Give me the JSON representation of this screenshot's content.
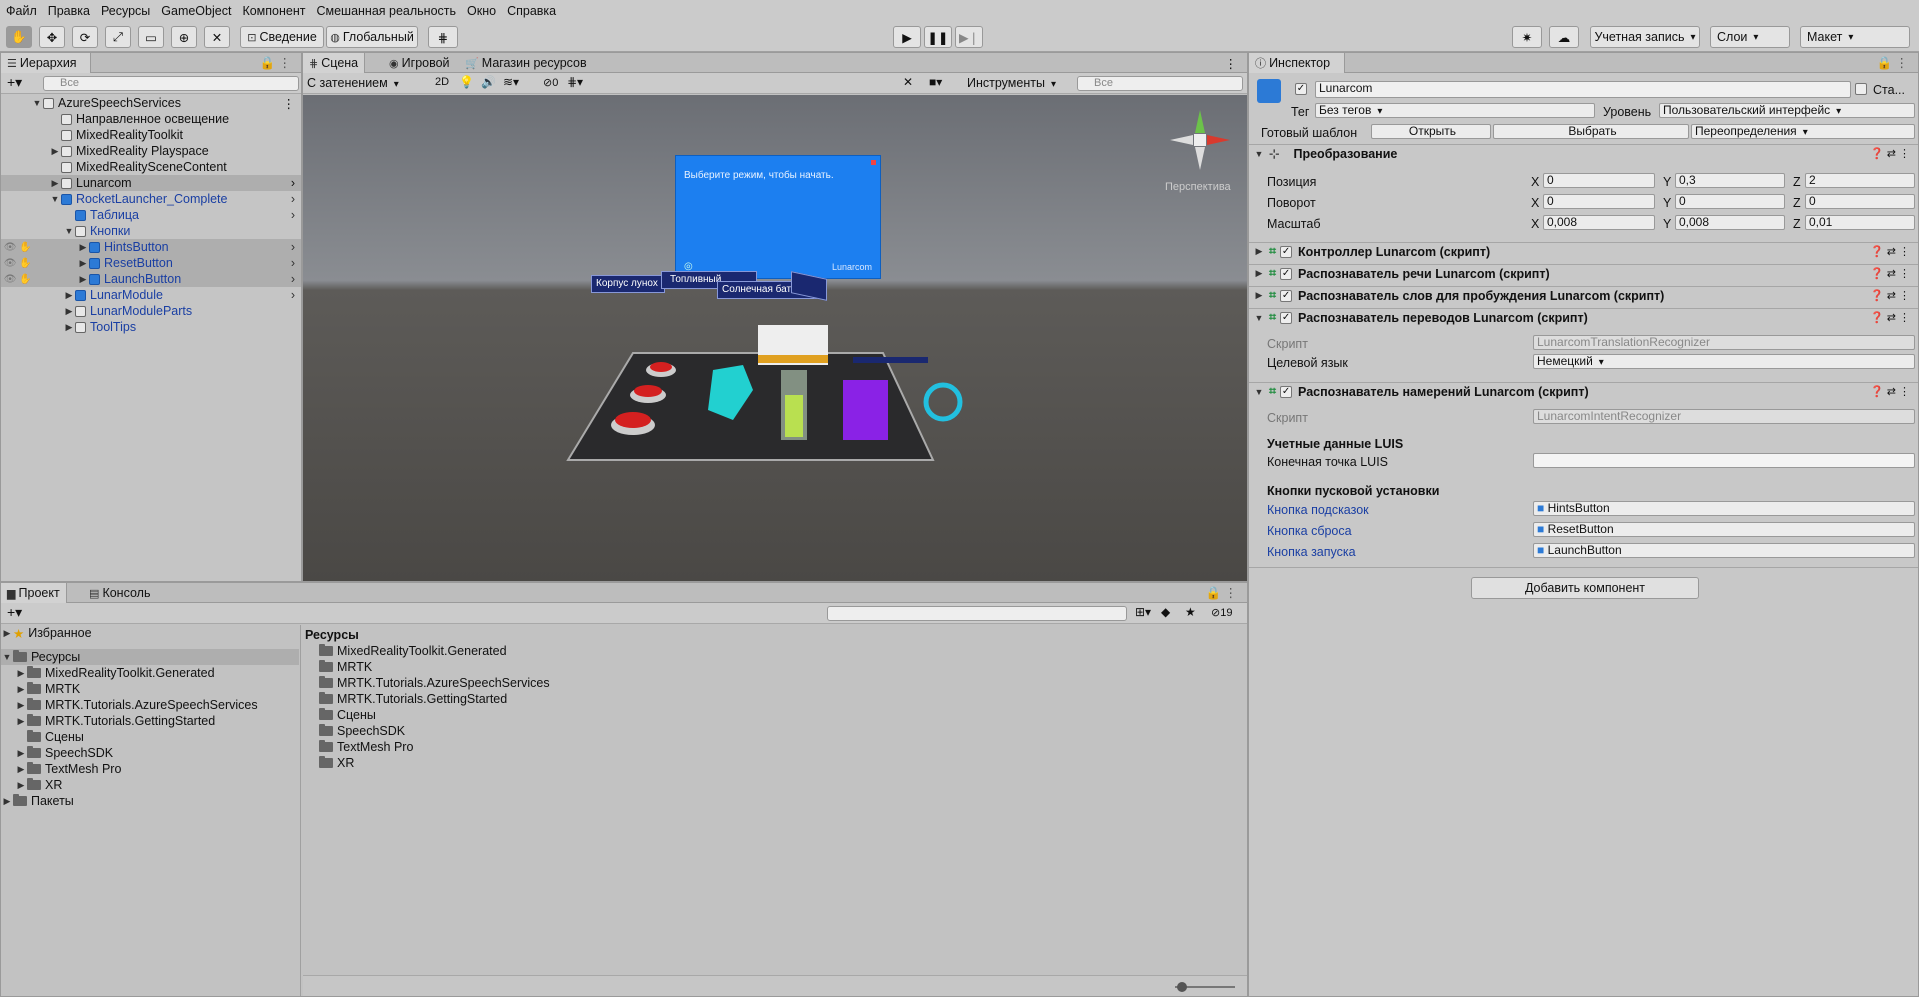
{
  "menu": [
    "Файл",
    "Правка",
    "Ресурсы",
    "GameObject",
    "Компонент",
    "Смешанная реальность",
    "Окно",
    "Справка"
  ],
  "toolbar": {
    "pivot": "Сведение",
    "global": "Глобальный",
    "account": "Учетная запись",
    "layers": "Слои",
    "layout": "Макет"
  },
  "hierarchy": {
    "tab": "Иерархия",
    "search_placeholder": "Все",
    "items": [
      "AzureSpeechServices",
      "Направленное освещение",
      "MixedRealityToolkit",
      "MixedReality Playspace",
      "MixedRealitySceneContent",
      "Lunarcom",
      "RocketLauncher_Complete",
      "Таблица",
      "Кнопки",
      "HintsButton",
      "ResetButton",
      "LaunchButton",
      "LunarModule",
      "LunarModuleParts",
      "ToolTips"
    ]
  },
  "scene": {
    "tabs": [
      "Сцена",
      "Игровой",
      "Магазин ресурсов"
    ],
    "shading": "С затенением",
    "mode2d": "2D",
    "hidden_count": "0",
    "tools": "Инструменты",
    "search_placeholder": "Все",
    "persp": "Перспектива",
    "panel_text": "Выберите режим, чтобы начать.",
    "panel_footer": "Lunarcom",
    "labels": [
      "Корпус лунох",
      "Топливный",
      "Солнечная батарея"
    ]
  },
  "inspector": {
    "tab": "Инспектор",
    "object_name": "Lunarcom",
    "static": "Ста...",
    "tag_label": "Тег",
    "tag_value": "Без тегов",
    "layer_label": "Уровень",
    "layer_value": "Пользовательский интерфейс",
    "prefab_label": "Готовый шаблон",
    "open": "Открыть",
    "select": "Выбрать",
    "overrides": "Переопределения",
    "transform": {
      "title": "Преобразование",
      "rows": [
        {
          "label": "Позиция",
          "x": "0",
          "y": "0,3",
          "z": "2"
        },
        {
          "label": "Поворот",
          "x": "0",
          "y": "0",
          "z": "0"
        },
        {
          "label": "Масштаб",
          "x": "0,008",
          "y": "0,008",
          "z": "0,01"
        }
      ]
    },
    "axes": [
      "X",
      "Y",
      "Z"
    ],
    "components": [
      "Контроллер Lunarcom (скрипт)",
      "Распознаватель речи Lunarcom (скрипт)",
      "Распознаватель слов для пробуждения Lunarcom (скрипт)",
      "Распознаватель переводов Lunarcom (скрипт)",
      "Распознаватель намерений Lunarcom (скрипт)"
    ],
    "translation": {
      "script_label": "Скрипт",
      "script_value": "LunarcomTranslationRecognizer",
      "lang_label": "Целевой язык",
      "lang_value": "Немецкий"
    },
    "intent": {
      "script_label": "Скрипт",
      "script_value": "LunarcomIntentRecognizer",
      "luis_header": "Учетные данные LUIS",
      "endpoint_label": "Конечная точка LUIS",
      "buttons_header": "Кнопки пусковой установки",
      "buttons": [
        {
          "label": "Кнопка подсказок",
          "value": "HintsButton"
        },
        {
          "label": "Кнопка сброса",
          "value": "ResetButton"
        },
        {
          "label": "Кнопка запуска",
          "value": "LaunchButton"
        }
      ]
    },
    "add_component": "Добавить компонент"
  },
  "project": {
    "tabs": [
      "Проект",
      "Консоль"
    ],
    "hidden_count": "19",
    "tree": [
      "Избранное",
      "Ресурсы",
      "MixedRealityToolkit.Generated",
      "MRTK",
      "MRTK.Tutorials.AzureSpeechServices",
      "MRTK.Tutorials.GettingStarted",
      "Сцены",
      "SpeechSDK",
      "TextMesh Pro",
      "XR",
      "Пакеты"
    ],
    "path": "Ресурсы",
    "folders": [
      "MixedRealityToolkit.Generated",
      "MRTK",
      "MRTK.Tutorials.AzureSpeechServices",
      "MRTK.Tutorials.GettingStarted",
      "Сцены",
      "SpeechSDK",
      "TextMesh Pro",
      "XR"
    ]
  }
}
